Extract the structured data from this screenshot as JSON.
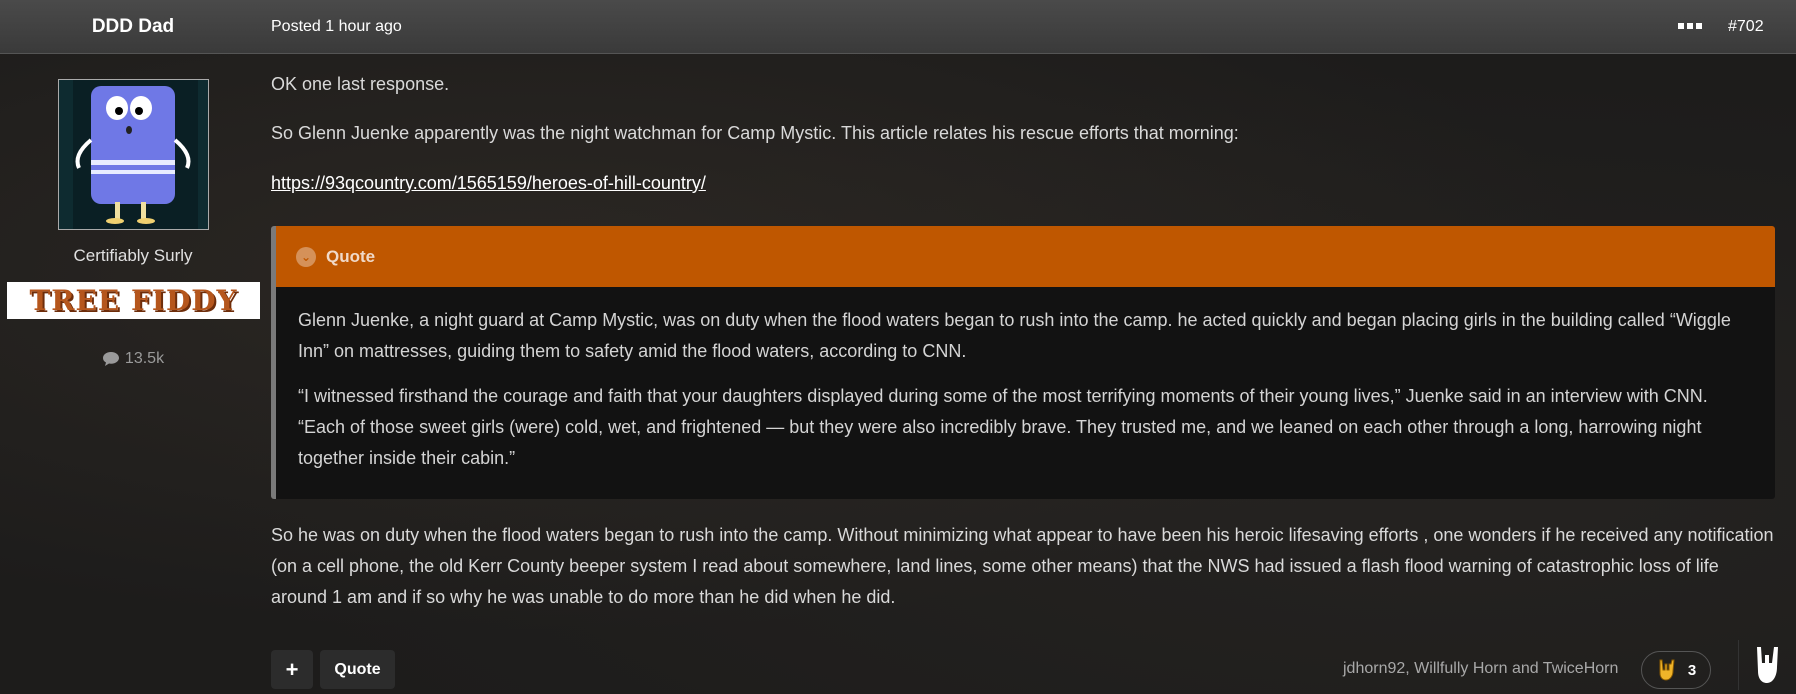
{
  "header": {
    "author": "DDD Dad",
    "posted": "Posted 1 hour ago",
    "post_number": "#702"
  },
  "sidebar": {
    "user_title": "Certifiably Surly",
    "banner_text": "TREE FIDDY",
    "post_count": "13.5k"
  },
  "post": {
    "p1": "OK one last response.",
    "p2": "So Glenn Juenke apparently was the night watchman for Camp Mystic.  This article relates his rescue efforts that morning:",
    "link": "https://93qcountry.com/1565159/heroes-of-hill-country/",
    "quote": {
      "label": "Quote",
      "p1": "Glenn Juenke, a night guard at Camp Mystic, was on duty when the flood waters began to rush into the camp. he acted quickly and began placing girls in the building called “Wiggle Inn” on mattresses, guiding them to safety amid the flood waters, according to CNN.",
      "p2": "“I witnessed firsthand the courage and faith that your daughters displayed during some of the most terrifying moments of their young lives,” Juenke said in an interview with CNN. “Each of those sweet girls (were) cold, wet, and frightened — but they were also incredibly brave. They trusted me, and we leaned on each other through a long, harrowing night together inside their cabin.”"
    },
    "p3": "So he was on duty when the flood waters began to rush into the camp.  Without minimizing what appear to have been his heroic lifesaving efforts , one wonders if he received any notification (on a cell phone, the old Kerr County beeper system I read about somewhere, land lines, some other means) that the NWS had issued a flash flood warning of catastrophic loss of life around 1 am and if so why he was unable to do more than he did when he did."
  },
  "footer": {
    "plus_label": "+",
    "quote_label": "Quote",
    "reactors": "jdhorn92, Willfully Horn and TwiceHorn",
    "reaction_count": "3"
  },
  "colors": {
    "quote_header": "#bf5700",
    "banner_text": "#b5561c"
  }
}
